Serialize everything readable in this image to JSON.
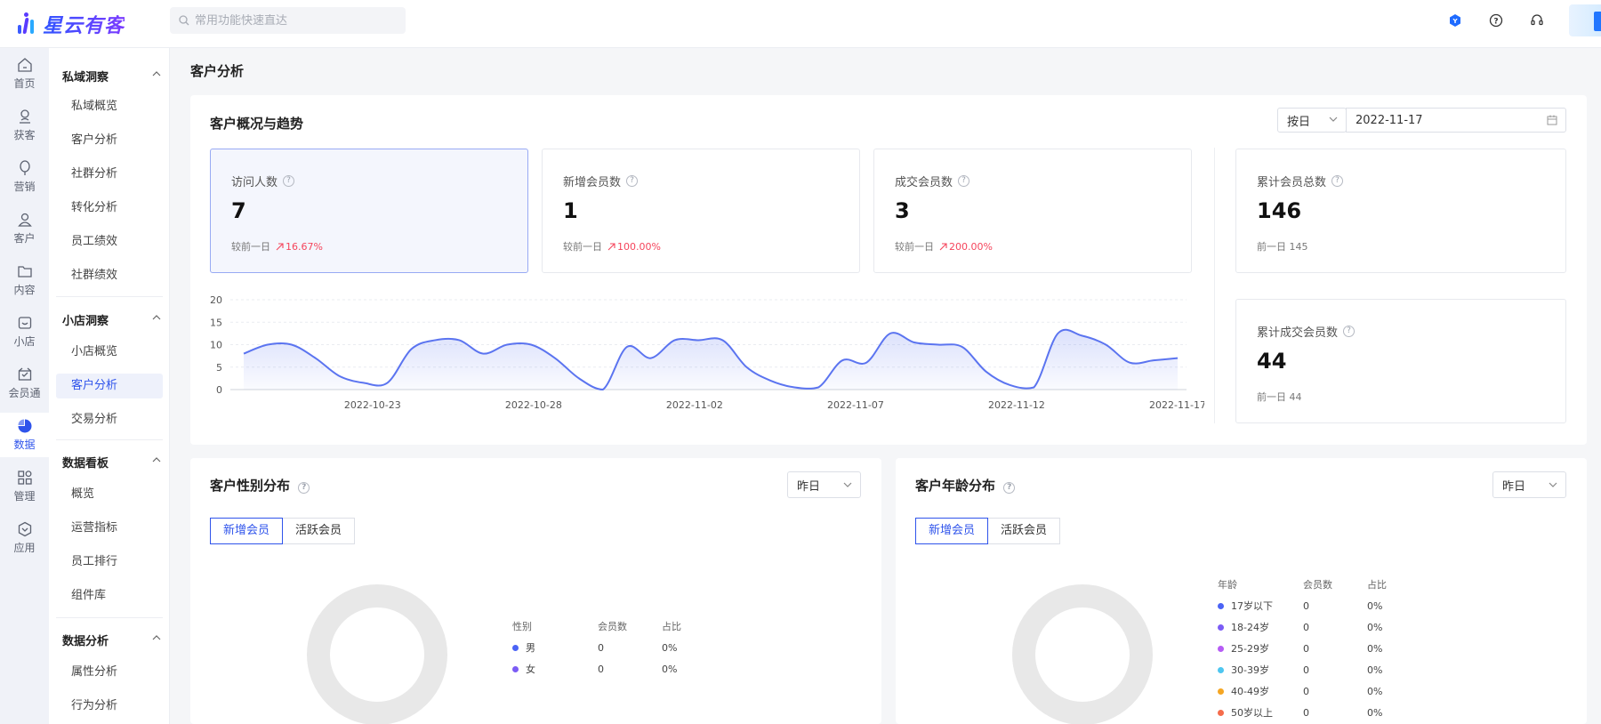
{
  "app": {
    "logo_text": "星云有客",
    "brand_color": "#2f54eb"
  },
  "search": {
    "placeholder": "常用功能快速直达"
  },
  "rail": [
    {
      "label": "首页",
      "icon": "home-icon"
    },
    {
      "label": "获客",
      "icon": "acquire-icon"
    },
    {
      "label": "营销",
      "icon": "balloon-icon"
    },
    {
      "label": "客户",
      "icon": "user-icon"
    },
    {
      "label": "内容",
      "icon": "folder-icon"
    },
    {
      "label": "小店",
      "icon": "shop-icon"
    },
    {
      "label": "会员通",
      "icon": "member-icon"
    },
    {
      "label": "数据",
      "icon": "pie-chart-icon",
      "active": true
    },
    {
      "label": "管理",
      "icon": "grid-icon"
    },
    {
      "label": "应用",
      "icon": "app-icon"
    }
  ],
  "submenu": {
    "groups": [
      {
        "title": "私域洞察",
        "items": [
          "私域概览",
          "客户分析",
          "社群分析",
          "转化分析",
          "员工绩效",
          "社群绩效"
        ]
      },
      {
        "title": "小店洞察",
        "items": [
          "小店概览",
          "客户分析",
          "交易分析"
        ]
      },
      {
        "title": "数据看板",
        "items": [
          "概览",
          "运营指标",
          "员工排行",
          "组件库"
        ]
      },
      {
        "title": "数据分析",
        "items": [
          "属性分析",
          "行为分析"
        ]
      }
    ],
    "active_item": "客户分析"
  },
  "page_title": "客户分析",
  "overview": {
    "title": "客户概况与趋势",
    "period_select": "按日",
    "date_value": "2022-11-17",
    "stats": [
      {
        "label": "访问人数",
        "value": "7",
        "compare_label": "较前一日",
        "change": "16.67%"
      },
      {
        "label": "新增会员数",
        "value": "1",
        "compare_label": "较前一日",
        "change": "100.00%"
      },
      {
        "label": "成交会员数",
        "value": "3",
        "compare_label": "较前一日",
        "change": "200.00%"
      }
    ],
    "totals": [
      {
        "label": "累计会员总数",
        "value": "146",
        "prev": "前一日 145"
      },
      {
        "label": "累计成交会员数",
        "value": "44",
        "prev": "前一日 44"
      }
    ]
  },
  "chart_data": {
    "type": "area",
    "title": "",
    "xlabel": "",
    "ylabel": "",
    "ylim": [
      0,
      20
    ],
    "yticks": [
      "0",
      "5",
      "10",
      "15",
      "20"
    ],
    "x_tick_labels": [
      "2022-10-23",
      "2022-10-28",
      "2022-11-02",
      "2022-11-07",
      "2022-11-12",
      "2022-11-17"
    ],
    "x_start": "2022-10-19",
    "x_end": "2022-11-17",
    "values": [
      8,
      10,
      10,
      7,
      3,
      1.5,
      1.5,
      9,
      11,
      11,
      8,
      10,
      10,
      7,
      2.5,
      0,
      9.5,
      7,
      11,
      11,
      11,
      5,
      2,
      0.5,
      0.5,
      6.5,
      6,
      12.5,
      10.5,
      10,
      9.5,
      4,
      1,
      0.5,
      12.5,
      12,
      10,
      6,
      6.5,
      7
    ],
    "grid": true,
    "series_color": "#5b74f0"
  },
  "gender": {
    "title": "客户性别分布",
    "period": "昨日",
    "tabs": [
      "新增会员",
      "活跃会员"
    ],
    "headers": [
      "性别",
      "会员数",
      "占比"
    ],
    "rows": [
      {
        "label": "男",
        "count": "0",
        "ratio": "0%",
        "color": "#4b63f5"
      },
      {
        "label": "女",
        "count": "0",
        "ratio": "0%",
        "color": "#7b5cf5"
      }
    ]
  },
  "age": {
    "title": "客户年龄分布",
    "period": "昨日",
    "tabs": [
      "新增会员",
      "活跃会员"
    ],
    "headers": [
      "年龄",
      "会员数",
      "占比"
    ],
    "rows": [
      {
        "label": "17岁以下",
        "count": "0",
        "ratio": "0%",
        "color": "#4b63f5"
      },
      {
        "label": "18-24岁",
        "count": "0",
        "ratio": "0%",
        "color": "#7b5cf5"
      },
      {
        "label": "25-29岁",
        "count": "0",
        "ratio": "0%",
        "color": "#b65cf5"
      },
      {
        "label": "30-39岁",
        "count": "0",
        "ratio": "0%",
        "color": "#4ec6f0"
      },
      {
        "label": "40-49岁",
        "count": "0",
        "ratio": "0%",
        "color": "#f5a623"
      },
      {
        "label": "50岁以上",
        "count": "0",
        "ratio": "0%",
        "color": "#f56c4b"
      }
    ]
  }
}
